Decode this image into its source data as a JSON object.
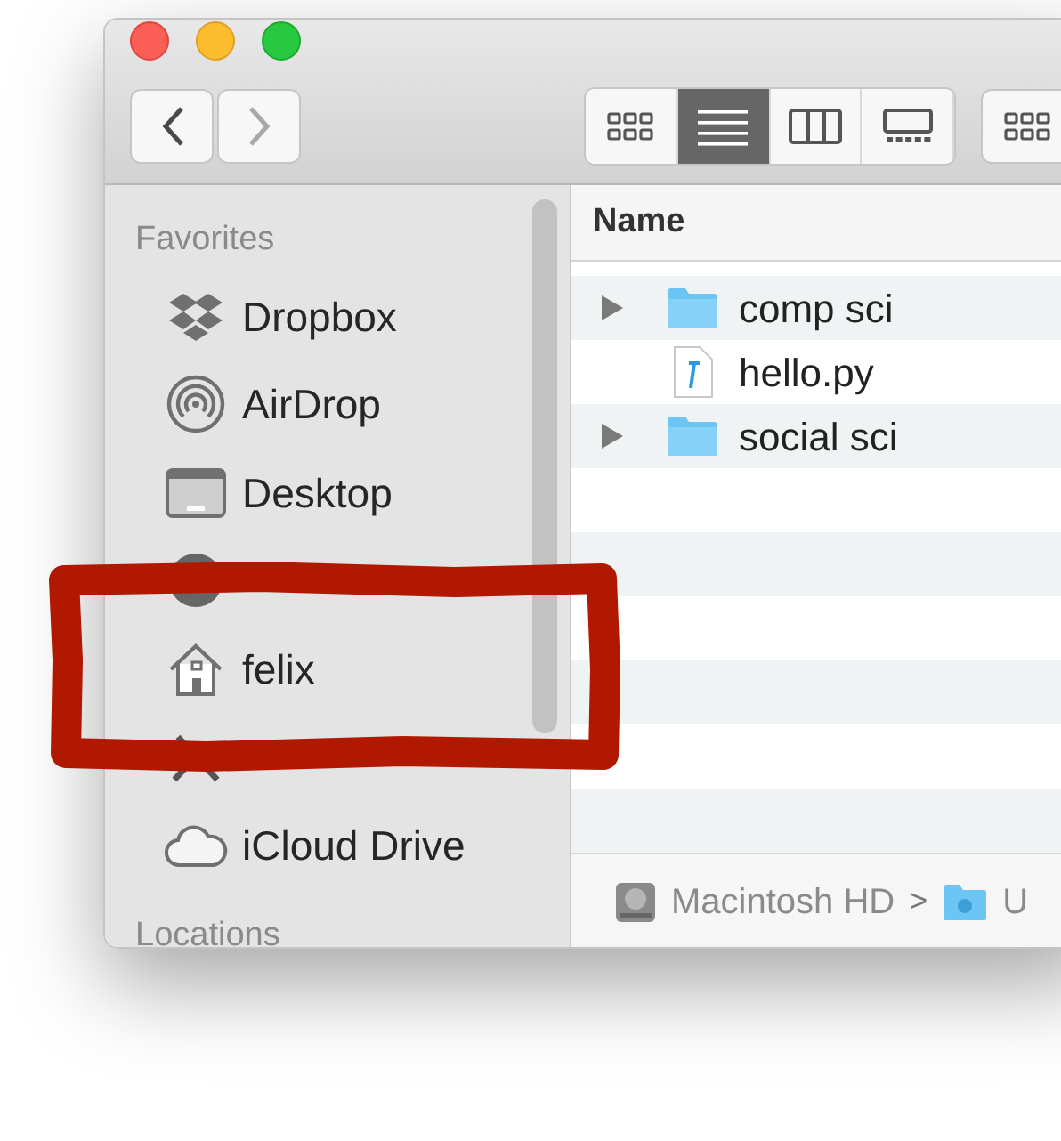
{
  "toolbar": {
    "nav_buttons": [
      {
        "kind": "back",
        "disabled": false
      },
      {
        "kind": "forward",
        "disabled": true
      }
    ],
    "view_modes": [
      {
        "kind": "icons",
        "selected": false
      },
      {
        "kind": "list",
        "selected": true
      },
      {
        "kind": "columns",
        "selected": false
      },
      {
        "kind": "gallery",
        "selected": false
      }
    ]
  },
  "sidebar": {
    "section": "Favorites",
    "items": [
      {
        "kind": "dropbox",
        "label": "Dropbox"
      },
      {
        "kind": "airdrop",
        "label": "AirDrop"
      },
      {
        "kind": "desktop",
        "label": "Desktop"
      },
      {
        "kind": "downloads"
      },
      {
        "kind": "home",
        "label": "felix"
      },
      {
        "kind": "applications"
      },
      {
        "kind": "cloud",
        "label": "iCloud Drive"
      }
    ],
    "next_section": "Locations"
  },
  "file_list": {
    "columns": [
      "Name"
    ],
    "rows": [
      {
        "kind": "folder",
        "name": "comp sci",
        "expandable": true
      },
      {
        "kind": "python",
        "name": "hello.py",
        "expandable": false
      },
      {
        "kind": "folder",
        "name": "social sci",
        "expandable": true
      }
    ]
  },
  "path_bar": [
    {
      "kind": "disk",
      "label": "Macintosh HD"
    },
    {
      "kind": "separator",
      "label": ">"
    },
    {
      "kind": "user-folder",
      "label": "U"
    }
  ],
  "annotation": {
    "kind": "rectangle",
    "color": "#b01800"
  }
}
